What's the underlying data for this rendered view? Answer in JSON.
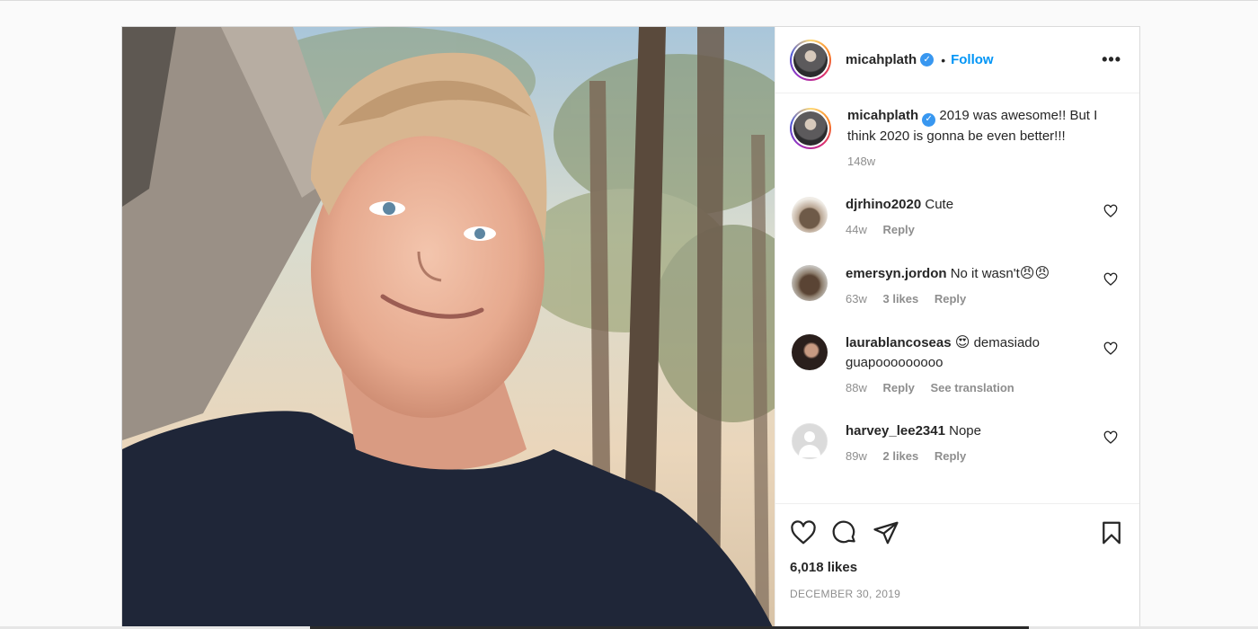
{
  "post": {
    "author": {
      "username": "micahplath",
      "verified": true,
      "follow_label": "Follow",
      "separator": "•",
      "more_label": "•••"
    },
    "caption": {
      "username": "micahplath",
      "text": "2019 was awesome!! But I think 2020 is gonna be even better!!!",
      "age": "148w"
    },
    "comments": [
      {
        "username": "djrhino2020",
        "text": "Cute",
        "age": "44w",
        "likes": "",
        "reply": "Reply",
        "translate": ""
      },
      {
        "username": "emersyn.jordon",
        "text": "No it wasn't",
        "emoji": "😠😠",
        "age": "63w",
        "likes": "3 likes",
        "reply": "Reply",
        "translate": ""
      },
      {
        "username": "laurablancoseas",
        "emoji": "😍",
        "text": "demasiado guapooooooooo",
        "age": "88w",
        "likes": "",
        "reply": "Reply",
        "translate": "See translation"
      },
      {
        "username": "harvey_lee2341",
        "text": "Nope",
        "age": "89w",
        "likes": "2 likes",
        "reply": "Reply",
        "translate": ""
      }
    ],
    "likes": "6,018 likes",
    "date": "DECEMBER 30, 2019",
    "icons": [
      "heart-icon",
      "comment-icon",
      "share-icon",
      "bookmark-icon",
      "verified-badge-icon",
      "more-options-icon"
    ]
  }
}
